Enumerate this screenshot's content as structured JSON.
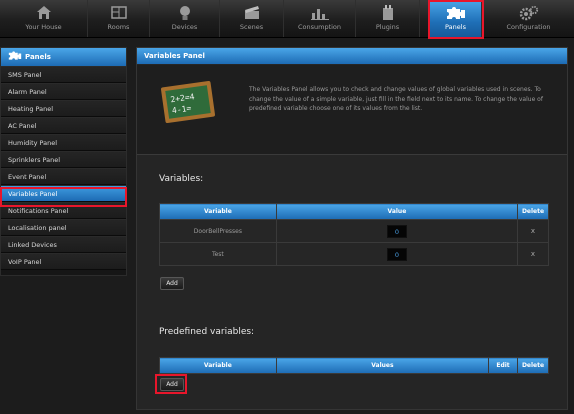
{
  "nav": {
    "items": [
      {
        "label": "Your House",
        "icon": "house-icon"
      },
      {
        "label": "Rooms",
        "icon": "rooms-icon"
      },
      {
        "label": "Devices",
        "icon": "bulb-icon"
      },
      {
        "label": "Scenes",
        "icon": "clapper-icon"
      },
      {
        "label": "Consumption",
        "icon": "chart-icon"
      },
      {
        "label": "Plugins",
        "icon": "plugin-icon"
      },
      {
        "label": "Panels",
        "icon": "puzzle-icon"
      },
      {
        "label": "Configuration",
        "icon": "gears-icon"
      }
    ],
    "active_index": 6
  },
  "sidebar": {
    "title": "Panels",
    "items": [
      {
        "label": "SMS Panel"
      },
      {
        "label": "Alarm Panel"
      },
      {
        "label": "Heating Panel"
      },
      {
        "label": "AC Panel"
      },
      {
        "label": "Humidity Panel"
      },
      {
        "label": "Sprinklers Panel"
      },
      {
        "label": "Event Panel"
      },
      {
        "label": "Variables Panel"
      },
      {
        "label": "Notifications Panel"
      },
      {
        "label": "Localisation panel"
      },
      {
        "label": "Linked Devices"
      },
      {
        "label": "VoIP Panel"
      }
    ],
    "active_index": 7
  },
  "main": {
    "title": "Variables Panel",
    "intro": "The Variables Panel allows you to check and change values of global variables used in scenes. To change the value of a simple variable, just fill in the field next to its name. To change the value of predefined variable choose one of its values from the list.",
    "chalkboard_text": "2+2=4 4-1=",
    "variables": {
      "heading": "Variables:",
      "columns": {
        "variable": "Variable",
        "value": "Value",
        "delete": "Delete"
      },
      "rows": [
        {
          "name": "DoorBellPresses",
          "value": "0",
          "delete": "x"
        },
        {
          "name": "Test",
          "value": "0",
          "delete": "x"
        }
      ],
      "add_label": "Add"
    },
    "predefined": {
      "heading": "Predefined variables:",
      "columns": {
        "variable": "Variable",
        "values": "Values",
        "edit": "Edit",
        "delete": "Delete"
      },
      "add_label": "Add"
    }
  },
  "colors": {
    "accent": "#2b86d1",
    "highlight": "#e8162b",
    "background": "#1c1c1c"
  }
}
